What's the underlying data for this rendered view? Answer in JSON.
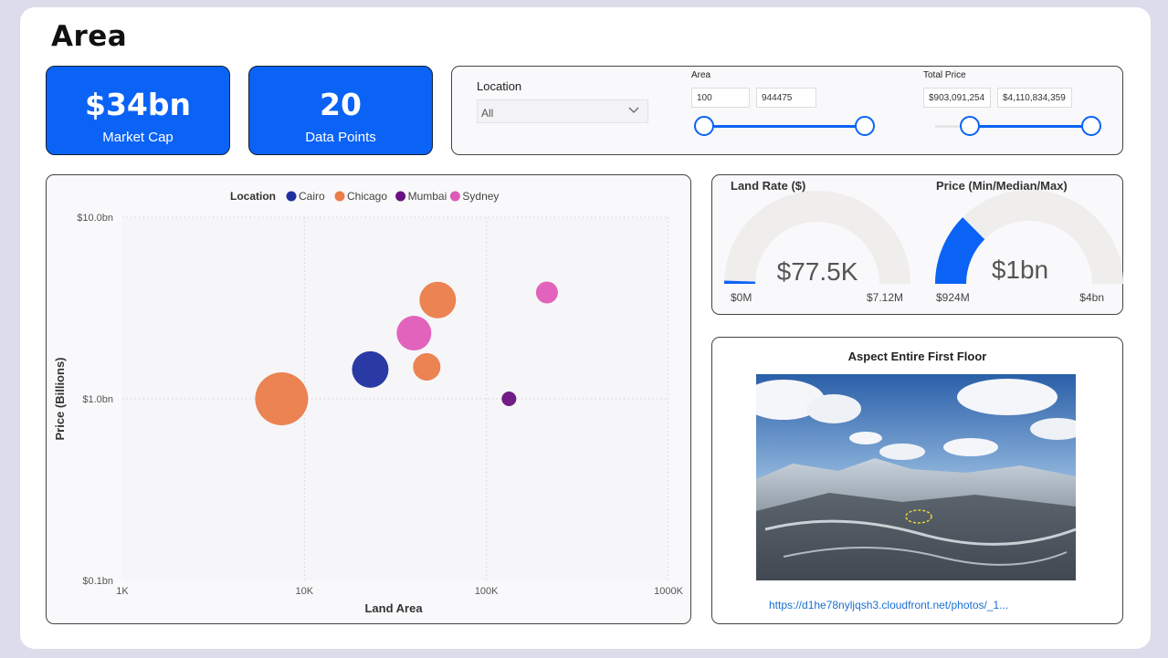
{
  "page": {
    "title": "Area"
  },
  "kpis": {
    "market_cap": {
      "value": "$34bn",
      "label": "Market Cap"
    },
    "data_points": {
      "value": "20",
      "label": "Data Points"
    }
  },
  "filters": {
    "location": {
      "label": "Location",
      "value": "All"
    },
    "area": {
      "label": "Area",
      "min": "100",
      "max": "944475"
    },
    "total_price": {
      "label": "Total Price",
      "min": "$903,091,254",
      "max": "$4,110,834,359"
    }
  },
  "gauges": {
    "land_rate": {
      "title": "Land Rate ($)",
      "value": "$77.5K",
      "min": "$0M",
      "max": "$7.12M",
      "fill_fraction": 0.011
    },
    "price": {
      "title": "Price (Min/Median/Max)",
      "value": "$1bn",
      "min": "$924M",
      "max": "$4bn",
      "fill_fraction": 0.25
    }
  },
  "image_card": {
    "title": "Aspect Entire First Floor",
    "link": "https://d1he78nyljqsh3.cloudfront.net/photos/_1..."
  },
  "colors": {
    "accent": "#0b63f6",
    "Cairo": "#1f2fa0",
    "Chicago": "#ea7c4a",
    "Mumbai": "#6a1080",
    "Sydney": "#df5bb8"
  },
  "chart_data": {
    "type": "scatter",
    "legend_title": "Location",
    "legend_position": "top-center",
    "xlabel": "Land Area",
    "ylabel": "Price (Billions)",
    "x_scale": "log",
    "y_scale": "log",
    "xlim": [
      1000,
      1000000
    ],
    "ylim": [
      0.1,
      10
    ],
    "x_ticks": [
      "1K",
      "10K",
      "100K",
      "1000K"
    ],
    "y_ticks": [
      "$0.1bn",
      "$1.0bn",
      "$10.0bn"
    ],
    "series": [
      {
        "name": "Cairo",
        "points": [
          {
            "x": 23000,
            "y": 1.45,
            "size": 20
          }
        ]
      },
      {
        "name": "Chicago",
        "points": [
          {
            "x": 7500,
            "y": 1.0,
            "size": 29
          },
          {
            "x": 54000,
            "y": 3.5,
            "size": 20
          },
          {
            "x": 47000,
            "y": 1.5,
            "size": 15
          }
        ]
      },
      {
        "name": "Mumbai",
        "points": [
          {
            "x": 133000,
            "y": 1.0,
            "size": 8
          }
        ]
      },
      {
        "name": "Sydney",
        "points": [
          {
            "x": 40000,
            "y": 2.3,
            "size": 19
          },
          {
            "x": 215000,
            "y": 3.85,
            "size": 12
          }
        ]
      }
    ]
  }
}
